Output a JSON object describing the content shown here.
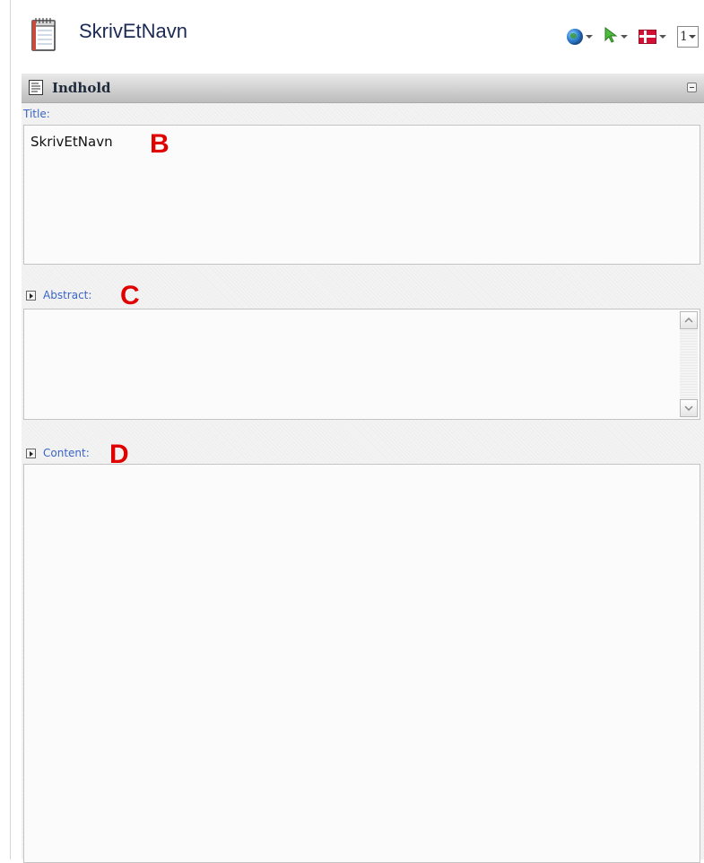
{
  "header": {
    "title": "SkrivEtNavn",
    "tools": [
      "globe-icon",
      "cursor-icon",
      "danish-flag-icon"
    ],
    "number_selector": "1"
  },
  "panel": {
    "title": "Indhold"
  },
  "fields": {
    "title": {
      "label": "Title:",
      "value": "SkrivEtNavn"
    },
    "abstract": {
      "label": "Abstract:",
      "value": ""
    },
    "content": {
      "label": "Content:",
      "value": ""
    }
  },
  "annotations": [
    "B",
    "C",
    "D"
  ],
  "colors": {
    "label": "#3a64c8",
    "annotation": "#e00000",
    "title_text": "#1b2a55"
  }
}
